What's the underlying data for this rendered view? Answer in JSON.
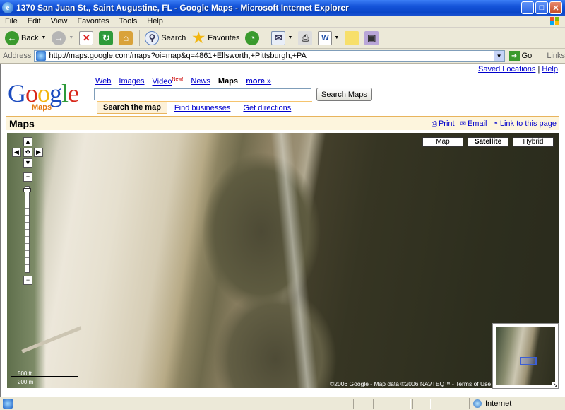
{
  "window": {
    "title": "1370 San Juan St., Saint Augustine, FL - Google Maps - Microsoft Internet Explorer"
  },
  "menu": {
    "items": [
      "File",
      "Edit",
      "View",
      "Favorites",
      "Tools",
      "Help"
    ]
  },
  "toolbar": {
    "back": "Back",
    "search": "Search",
    "favorites": "Favorites"
  },
  "address": {
    "label": "Address",
    "url": "http://maps.google.com/maps?oi=map&q=4861+Ellsworth,+Pittsburgh,+PA",
    "go": "Go",
    "links": "Links"
  },
  "page": {
    "saved_locations": "Saved Locations",
    "separator": "|",
    "help": "Help",
    "logo_text": "Google",
    "logo_sub": "Maps",
    "nav": {
      "web": "Web",
      "images": "Images",
      "video": "Video",
      "video_badge": "New!",
      "news": "News",
      "maps": "Maps",
      "more": "more »"
    },
    "search_button": "Search Maps",
    "subtabs": {
      "search_map": "Search the map",
      "find_businesses": "Find businesses",
      "get_directions": "Get directions"
    },
    "maps_title": "Maps",
    "tools": {
      "print": "Print",
      "email": "Email",
      "link": "Link to this page"
    }
  },
  "map": {
    "types": {
      "map": "Map",
      "satellite": "Satellite",
      "hybrid": "Hybrid"
    },
    "selected_type": "Satellite",
    "scale": {
      "top": "500 ft",
      "bottom": "200 m"
    },
    "copyright": "©2006 Google - Map data ©2006 NAVTEQ™ -",
    "terms": "Terms of Use"
  },
  "status": {
    "zone": "Internet"
  }
}
